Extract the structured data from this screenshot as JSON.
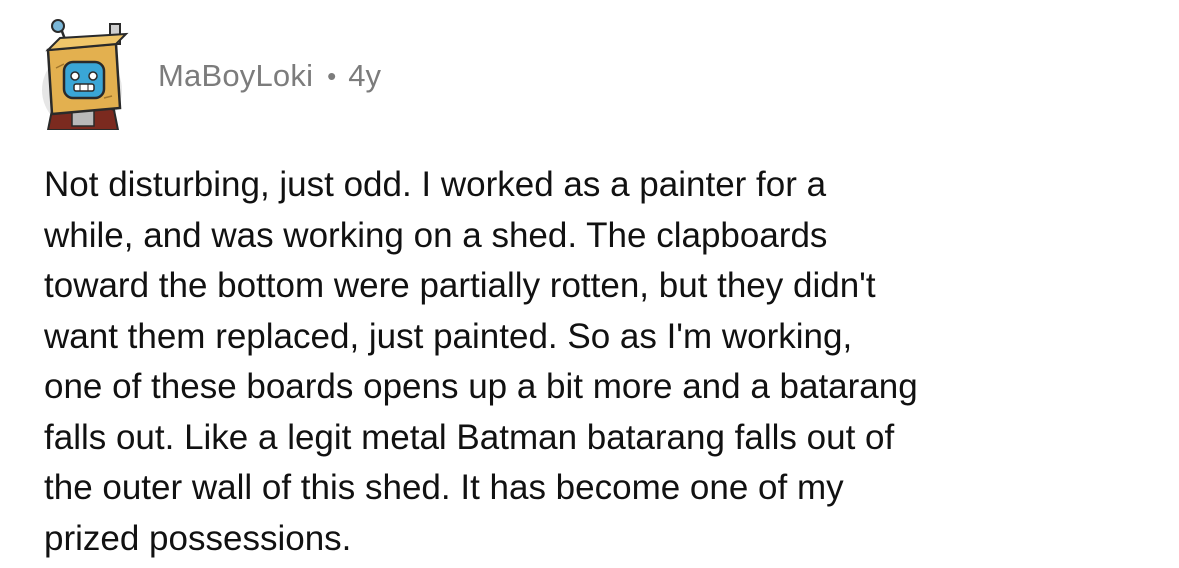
{
  "comment": {
    "author": "MaBoyLoki",
    "separator": "•",
    "age": "4y",
    "avatar_icon": "robot-box-avatar-icon",
    "body_lines": [
      "Not disturbing, just odd. I worked as a painter for a",
      "while, and was working on a shed. The clapboards",
      "toward the bottom were partially rotten, but they didn't",
      "want them replaced, just painted. So as I'm working,",
      "one of these boards opens up a bit more and a batarang",
      "falls out. Like a legit metal Batman batarang falls out of",
      "the outer wall of this shed. It has become one of my",
      "prized possessions."
    ]
  },
  "colors": {
    "meta_text": "#7c7c7c",
    "body_text": "#111111",
    "background": "#ffffff"
  }
}
